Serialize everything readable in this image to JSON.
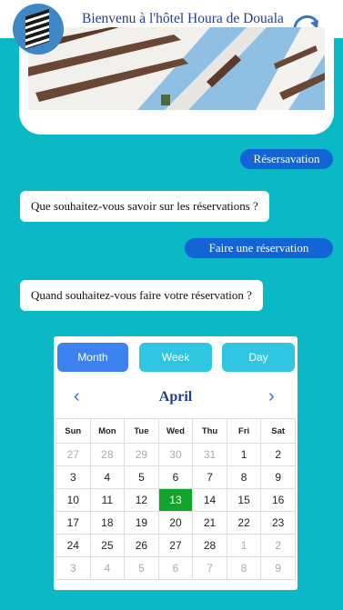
{
  "header": {
    "title": "Bienvenu à l'hôtel Houra de Douala"
  },
  "chat": {
    "chip_1": "Résersavation",
    "bubble_1": "Que souhaitez-vous savoir sur les réservations ?",
    "chip_2": "Faire une réservation",
    "bubble_2": "Quand souhaitez-vous faire votre réservation ?"
  },
  "calendar": {
    "views": [
      "Month",
      "Week",
      "Day"
    ],
    "active_view": "Month",
    "month": "April",
    "prev_icon": "chevron-left-icon",
    "next_icon": "chevron-right-icon",
    "weekdays": [
      "Sun",
      "Mon",
      "Tue",
      "Wed",
      "Thu",
      "Fri",
      "Sat"
    ],
    "weeks": [
      [
        "27",
        "28",
        "29",
        "30",
        "31",
        "1",
        "2"
      ],
      [
        "3",
        "4",
        "5",
        "6",
        "7",
        "8",
        "9"
      ],
      [
        "10",
        "11",
        "12",
        "13",
        "14",
        "15",
        "16"
      ],
      [
        "17",
        "18",
        "19",
        "20",
        "21",
        "22",
        "23"
      ],
      [
        "24",
        "25",
        "26",
        "27",
        "28",
        "1",
        "2"
      ],
      [
        "3",
        "4",
        "5",
        "6",
        "7",
        "8",
        "9"
      ]
    ],
    "selected_day": "13",
    "accent": "#13a52b"
  },
  "colors": {
    "background": "#0bb8c6",
    "chip": "#1364d6",
    "title": "#2b3c8c"
  }
}
